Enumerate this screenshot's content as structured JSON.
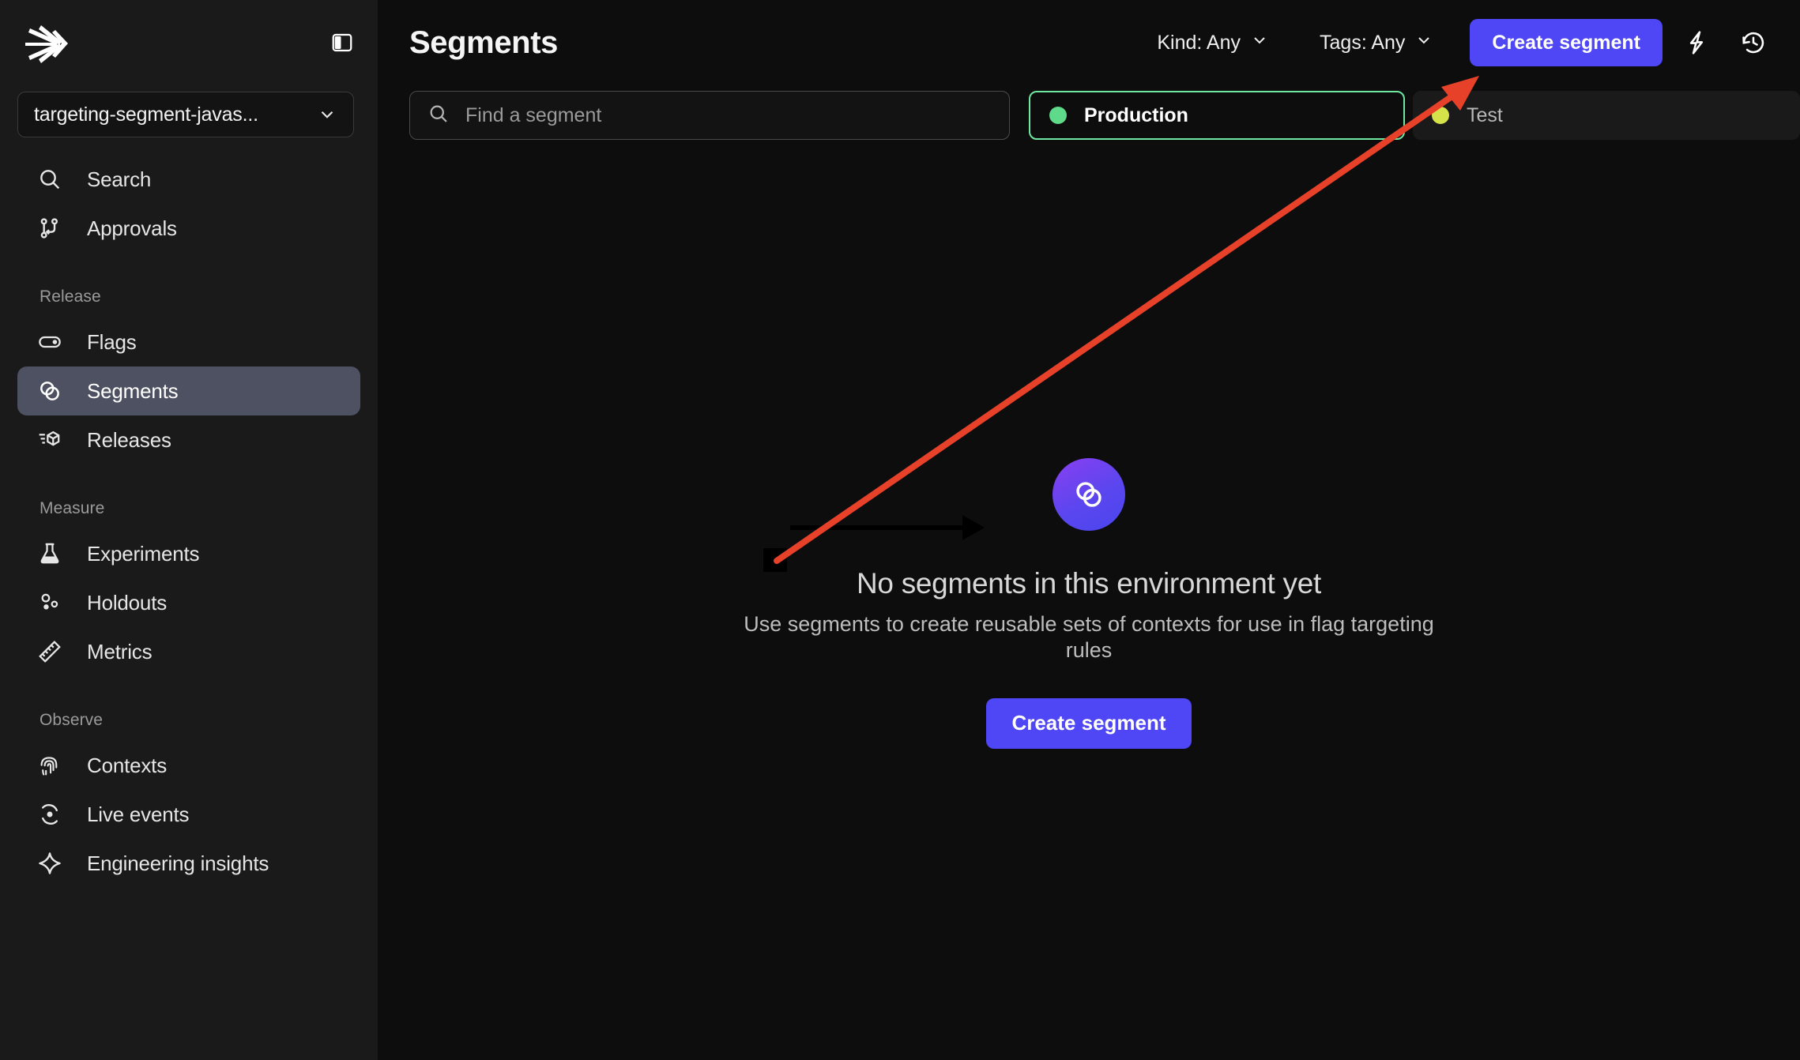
{
  "sidebar": {
    "logo_icon": "launchdarkly-logo-icon",
    "panel_toggle_icon": "sidebar-toggle-icon",
    "project": {
      "name": "targeting-segment-javas...",
      "chevron_icon": "chevron-down-icon"
    },
    "top_items": [
      {
        "label": "Search",
        "icon": "search-icon"
      },
      {
        "label": "Approvals",
        "icon": "approvals-icon"
      }
    ],
    "sections": [
      {
        "title": "Release",
        "items": [
          {
            "label": "Flags",
            "icon": "toggle-icon",
            "active": false
          },
          {
            "label": "Segments",
            "icon": "segments-icon",
            "active": true
          },
          {
            "label": "Releases",
            "icon": "releases-cube-icon",
            "active": false
          }
        ]
      },
      {
        "title": "Measure",
        "items": [
          {
            "label": "Experiments",
            "icon": "flask-icon",
            "active": false
          },
          {
            "label": "Holdouts",
            "icon": "holdouts-icon",
            "active": false
          },
          {
            "label": "Metrics",
            "icon": "ruler-icon",
            "active": false
          }
        ]
      },
      {
        "title": "Observe",
        "items": [
          {
            "label": "Contexts",
            "icon": "fingerprint-icon",
            "active": false
          },
          {
            "label": "Live events",
            "icon": "live-events-icon",
            "active": false
          },
          {
            "label": "Engineering insights",
            "icon": "sparkle-icon",
            "active": false
          }
        ]
      }
    ]
  },
  "header": {
    "title": "Segments",
    "filters": [
      {
        "label": "Kind: Any",
        "icon": "chevron-down-icon"
      },
      {
        "label": "Tags: Any",
        "icon": "chevron-down-icon"
      }
    ],
    "create_label": "Create segment",
    "quick_action_icon": "lightning-bolt-icon",
    "history_icon": "history-clock-icon"
  },
  "filter_row": {
    "search": {
      "placeholder": "Find a segment",
      "value": "",
      "icon": "search-icon"
    },
    "environments": [
      {
        "label": "Production",
        "dot_color": "#5fd98a",
        "selected": true
      },
      {
        "label": "Test",
        "dot_color": "#d6e24a",
        "selected": false
      }
    ],
    "selected_border_color": "#6ee7a0"
  },
  "empty_state": {
    "icon": "segments-icon",
    "title": "No segments in this environment yet",
    "description": "Use segments to create reusable sets of contexts for use in flag targeting rules",
    "button_label": "Create segment"
  },
  "annotations": {
    "red_arrow_color": "#e8412a",
    "black_arrow_color": "#000000",
    "marker_square_color": "#000000"
  }
}
